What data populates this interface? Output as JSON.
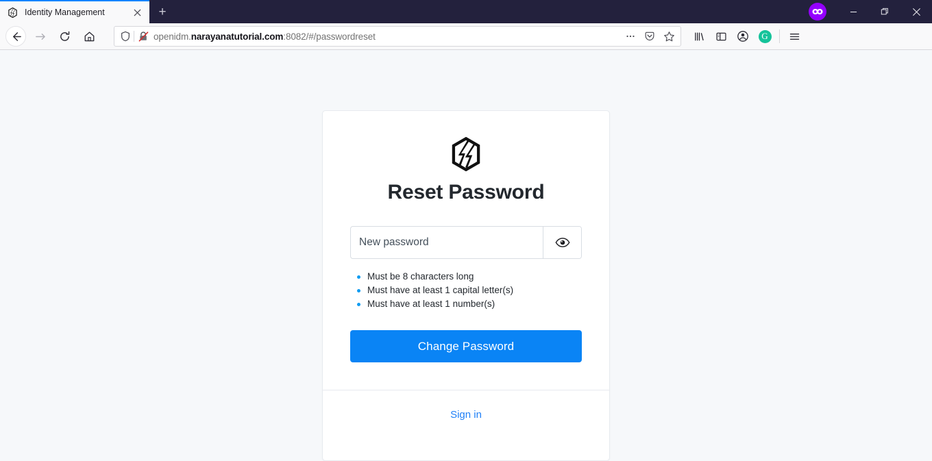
{
  "browser": {
    "tab": {
      "title": "Identity Management",
      "favicon_icon": "forgerock-logo-icon",
      "close_icon": "close-icon"
    },
    "new_tab_label": "+",
    "window_controls": {
      "container_icon": "private-mask-icon",
      "minimize_label": "─",
      "restore_label": "❐",
      "close_label": "✕"
    },
    "nav": {
      "back_icon": "back-arrow-icon",
      "forward_icon": "forward-arrow-icon",
      "reload_icon": "reload-icon",
      "home_icon": "home-icon"
    },
    "urlbar": {
      "shield_icon": "tracking-protection-shield-icon",
      "connection_icon": "insecure-connection-icon",
      "url_prefix": "openidm.",
      "url_host": "narayanatutorial.com",
      "url_suffix": ":8082/#/passwordreset",
      "full_url": "openidm.narayanatutorial.com:8082/#/passwordreset",
      "page_actions_icon": "ellipsis-icon",
      "pocket_icon": "pocket-save-icon",
      "bookmark_icon": "star-bookmark-icon"
    },
    "toolbar_right": {
      "library_icon": "library-icon",
      "sidebar_icon": "sidebar-icon",
      "account_icon": "account-icon",
      "grammarly_label": "G",
      "menu_icon": "hamburger-menu-icon"
    }
  },
  "page": {
    "logo_icon": "forgerock-logo-icon",
    "title": "Reset Password",
    "password_field": {
      "placeholder": "New password",
      "value": "",
      "reveal_icon": "eye-icon"
    },
    "requirements": [
      "Must be 8 characters long",
      "Must have at least 1 capital letter(s)",
      "Must have at least 1 number(s)"
    ],
    "submit_label": "Change Password",
    "signin_label": "Sign in"
  },
  "colors": {
    "accent_blue": "#0a84f5",
    "link_blue": "#2080f7",
    "bullet_blue": "#109cf1",
    "titlebar": "#23213d",
    "page_bg": "#f6f8fa",
    "grammarly_green": "#15c39a",
    "container_purple": "#9400ff"
  }
}
